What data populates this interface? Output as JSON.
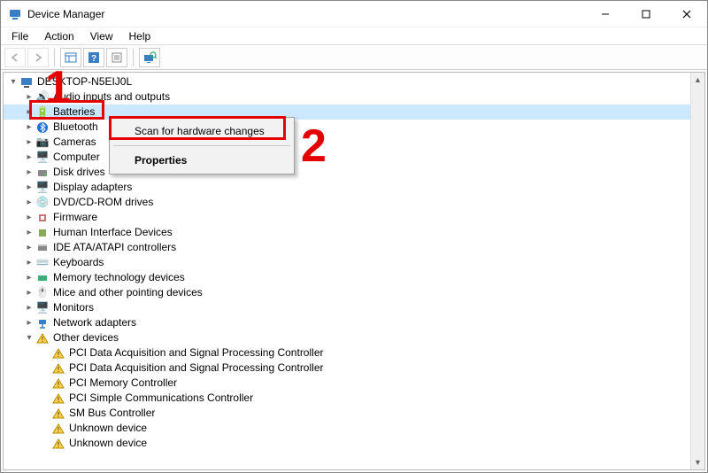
{
  "window": {
    "title": "Device Manager"
  },
  "menu": {
    "file": "File",
    "action": "Action",
    "view": "View",
    "help": "Help"
  },
  "tree": {
    "root": "DESKTOP-N5EIJ0L",
    "items": [
      {
        "label": "Audio inputs and outputs",
        "icon": "audio-icon"
      },
      {
        "label": "Batteries",
        "icon": "battery-icon",
        "selected": true
      },
      {
        "label": "Bluetooth",
        "icon": "bluetooth-icon"
      },
      {
        "label": "Cameras",
        "icon": "camera-icon"
      },
      {
        "label": "Computer",
        "icon": "computer-icon"
      },
      {
        "label": "Disk drives",
        "icon": "disk-icon"
      },
      {
        "label": "Display adapters",
        "icon": "display-icon"
      },
      {
        "label": "DVD/CD-ROM drives",
        "icon": "dvd-icon"
      },
      {
        "label": "Firmware",
        "icon": "firmware-icon"
      },
      {
        "label": "Human Interface Devices",
        "icon": "hid-icon"
      },
      {
        "label": "IDE ATA/ATAPI controllers",
        "icon": "ide-icon"
      },
      {
        "label": "Keyboards",
        "icon": "keyboard-icon"
      },
      {
        "label": "Memory technology devices",
        "icon": "memory-icon"
      },
      {
        "label": "Mice and other pointing devices",
        "icon": "mouse-icon"
      },
      {
        "label": "Monitors",
        "icon": "monitor-icon"
      },
      {
        "label": "Network adapters",
        "icon": "network-icon"
      },
      {
        "label": "Other devices",
        "icon": "warning-icon",
        "expanded": true,
        "children": [
          {
            "label": "PCI Data Acquisition and Signal Processing Controller",
            "icon": "warning-icon"
          },
          {
            "label": "PCI Data Acquisition and Signal Processing Controller",
            "icon": "warning-icon"
          },
          {
            "label": "PCI Memory Controller",
            "icon": "warning-icon"
          },
          {
            "label": "PCI Simple Communications Controller",
            "icon": "warning-icon"
          },
          {
            "label": "SM Bus Controller",
            "icon": "warning-icon"
          },
          {
            "label": "Unknown device",
            "icon": "warning-icon"
          },
          {
            "label": "Unknown device",
            "icon": "warning-icon"
          }
        ]
      }
    ]
  },
  "context_menu": {
    "scan": "Scan for hardware changes",
    "properties": "Properties"
  },
  "annotation": {
    "one": "1",
    "two": "2"
  }
}
